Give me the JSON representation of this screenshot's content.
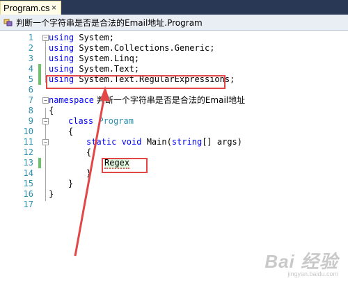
{
  "tab": {
    "title": "Program.cs",
    "close_glyph": "×"
  },
  "navbar": {
    "icon": "class-icon",
    "text": "判断一个字符串是否是合法的Email地址.Program"
  },
  "editor": {
    "line_numbers": [
      "1",
      "2",
      "3",
      "4",
      "5",
      "6",
      "7",
      "8",
      "9",
      "10",
      "11",
      "12",
      "13",
      "14",
      "15",
      "16",
      "17"
    ],
    "lines": {
      "l1_kw": "using",
      "l1_rest": " System;",
      "l2_kw": "using",
      "l2_rest": " System.Collections.Generic;",
      "l3_kw": "using",
      "l3_rest": " System.Linq;",
      "l4_kw": "using",
      "l4_rest": " System.Text;",
      "l5_kw": "using",
      "l5_rest": " System.Text.RegularExpressions;",
      "l7_kw": "namespace",
      "l7_name": " 判断一个字符串是否是合法的Email地址",
      "l8": "{",
      "l9_kw": "class",
      "l9_type": " Program",
      "l10": "{",
      "l11_kw1": "static",
      "l11_kw2": " void",
      "l11_rest1": " Main(",
      "l11_kw3": "string",
      "l11_rest2": "[] args)",
      "l12": "{",
      "l13": "Regex",
      "l14": "}",
      "l15": "}",
      "l16": "}"
    },
    "fold_glyph": "−"
  },
  "watermark": {
    "main": "Bai 经验",
    "sub": "jingyan.baidu.com"
  },
  "colors": {
    "keyword": "#0000ff",
    "type": "#2b91af",
    "annotation": "#e34646",
    "tab_strip": "#293955"
  }
}
